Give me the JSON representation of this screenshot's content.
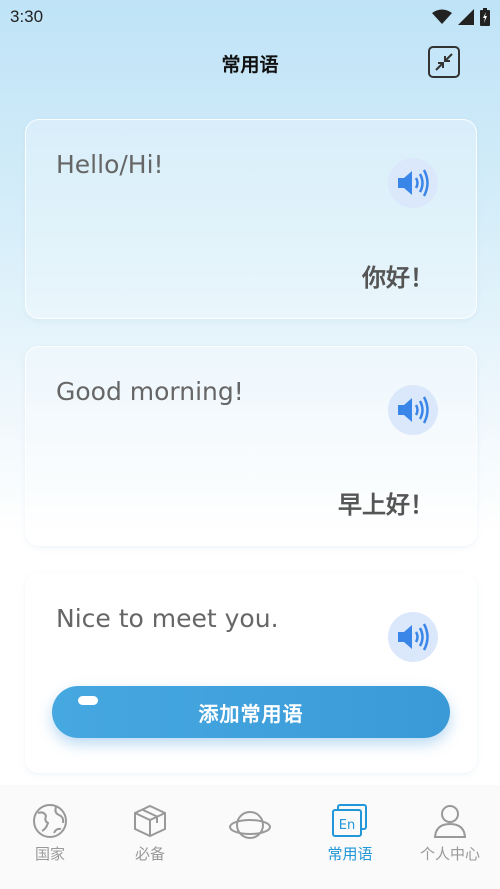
{
  "status": {
    "time": "3:30"
  },
  "header": {
    "title": "常用语"
  },
  "phrases": [
    {
      "en": "Hello/Hi!",
      "zh": "你好！"
    },
    {
      "en": "Good morning!",
      "zh": "早上好！"
    },
    {
      "en": "Nice to meet you.",
      "zh": ""
    }
  ],
  "add_button": {
    "label": "添加常用语"
  },
  "tabs": [
    {
      "label": "国家",
      "icon": "globe-icon",
      "active": false
    },
    {
      "label": "必备",
      "icon": "box-icon",
      "active": false
    },
    {
      "label": "",
      "icon": "planet-icon",
      "active": false
    },
    {
      "label": "常用语",
      "icon": "en-phrase-icon",
      "active": true
    },
    {
      "label": "个人中心",
      "icon": "person-icon",
      "active": false
    }
  ],
  "colors": {
    "accent": "#2196d8",
    "button": "#3a9ad8",
    "speaker_bg": "#dbe8fb",
    "speaker": "#3a86e8"
  }
}
